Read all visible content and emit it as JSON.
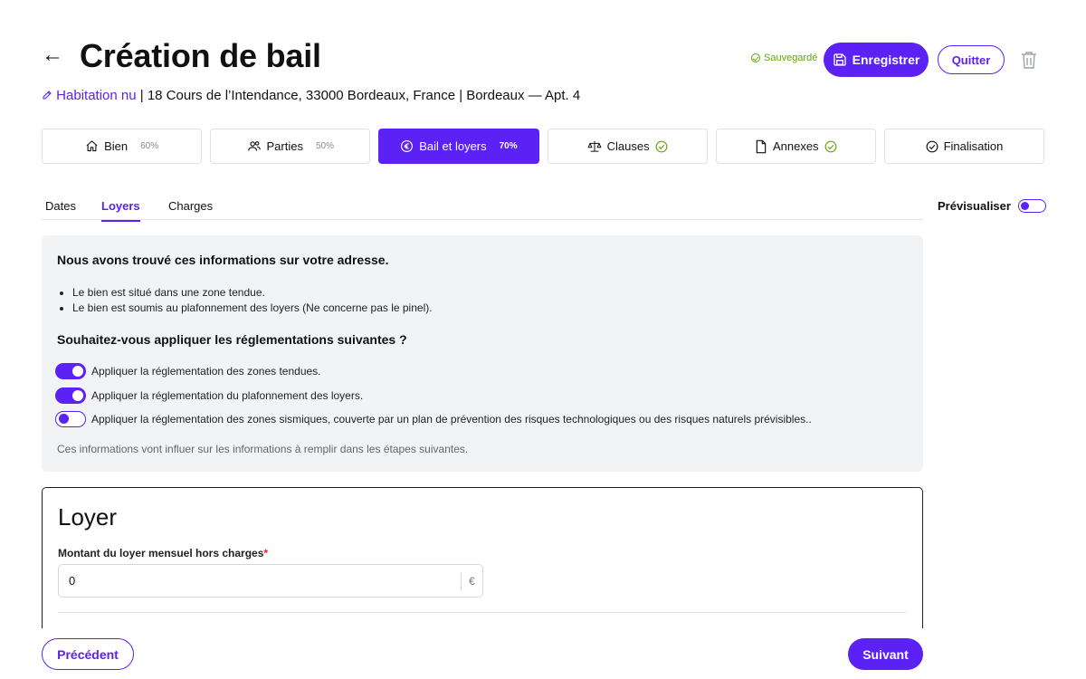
{
  "header": {
    "back_icon": "arrow-left-icon",
    "title": "Création de bail",
    "saved_label": "Sauvegardé",
    "save_label": "Enregistrer",
    "quit_label": "Quitter",
    "trash_icon": "trash-icon"
  },
  "subtitle": {
    "type_link": "Habitation nu",
    "address": " | 18 Cours de l’Intendance, 33000 Bordeaux, France | Bordeaux — Apt. 4"
  },
  "steps": [
    {
      "label": "Bien",
      "pct": "60%",
      "icon": "home-icon"
    },
    {
      "label": "Parties",
      "pct": "50%",
      "icon": "users-icon"
    },
    {
      "label": "Bail et loyers",
      "pct": "70%",
      "icon": "euro-icon",
      "active": true
    },
    {
      "label": "Clauses",
      "icon": "scale-icon",
      "status": "check-circle-icon"
    },
    {
      "label": "Annexes",
      "icon": "file-icon",
      "status": "check-circle-icon"
    },
    {
      "label": "Finalisation",
      "icon": "check-circle-icon"
    }
  ],
  "subtabs": {
    "dates": "Dates",
    "loyers": "Loyers",
    "charges": "Charges",
    "active": "Loyers"
  },
  "preview": {
    "label": "Prévisualiser",
    "enabled": false
  },
  "info": {
    "title": "Nous avons trouvé ces informations sur votre adresse.",
    "items": [
      "Le bien est situé dans une zone tendue.",
      "Le bien est soumis au plafonnement des loyers (Ne concerne pas le pinel)."
    ],
    "question": "Souhaitez-vous appliquer les réglementations suivantes ?",
    "toggles": [
      {
        "label": "Appliquer la réglementation des zones tendues.",
        "on": true
      },
      {
        "label": "Appliquer la réglementation du plafonnement des loyers.",
        "on": true
      },
      {
        "label": "Appliquer la réglementation des zones sismiques, couverte par un plan de prévention des risques technologiques ou des risques naturels prévisibles..",
        "on": false
      }
    ],
    "note": "Ces informations vont influer sur les informations à remplir dans les étapes suivantes."
  },
  "loyer": {
    "title": "Loyer",
    "field_label": "Montant du loyer mensuel hors charges",
    "required_mark": "*",
    "value": "0",
    "unit": "€"
  },
  "footer": {
    "prev_label": "Précédent",
    "next_label": "Suivant"
  },
  "colors": {
    "accent": "#5b21f5",
    "saved": "#65a30d",
    "info_bg": "#f2f3f5",
    "required": "#dc2626"
  }
}
